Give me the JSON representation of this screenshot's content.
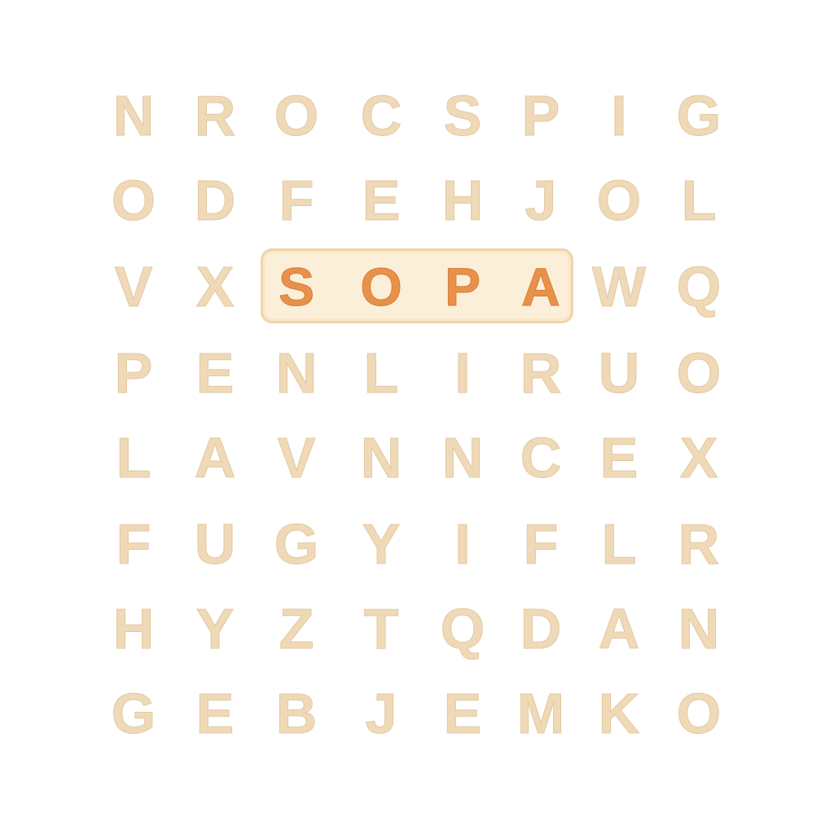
{
  "game": {
    "title": "",
    "grid": [
      [
        "N",
        "R",
        "O",
        "C",
        "S",
        "P",
        "I",
        "G"
      ],
      [
        "O",
        "D",
        "F",
        "E",
        "H",
        "J",
        "O",
        "L"
      ],
      [
        "V",
        "X",
        "S",
        "O",
        "P",
        "A",
        "W",
        "Q"
      ],
      [
        "P",
        "E",
        "N",
        "L",
        "I",
        "R",
        "U",
        "O"
      ],
      [
        "L",
        "A",
        "V",
        "N",
        "N",
        "C",
        "E",
        "X"
      ],
      [
        "F",
        "U",
        "G",
        "Y",
        "I",
        "F",
        "L",
        "R"
      ],
      [
        "H",
        "Y",
        "Z",
        "T",
        "Q",
        "D",
        "A",
        "N"
      ],
      [
        "G",
        "E",
        "B",
        "J",
        "E",
        "M",
        "K",
        "O"
      ]
    ],
    "found_word": {
      "word": "SOPA",
      "row": 2,
      "cols": [
        2,
        3,
        4,
        5
      ]
    },
    "colors": {
      "letter": "#efd9b7",
      "found_letter": "#e8914b",
      "highlight_fill": "#fcefd9",
      "highlight_border": "#efd5ad"
    }
  }
}
